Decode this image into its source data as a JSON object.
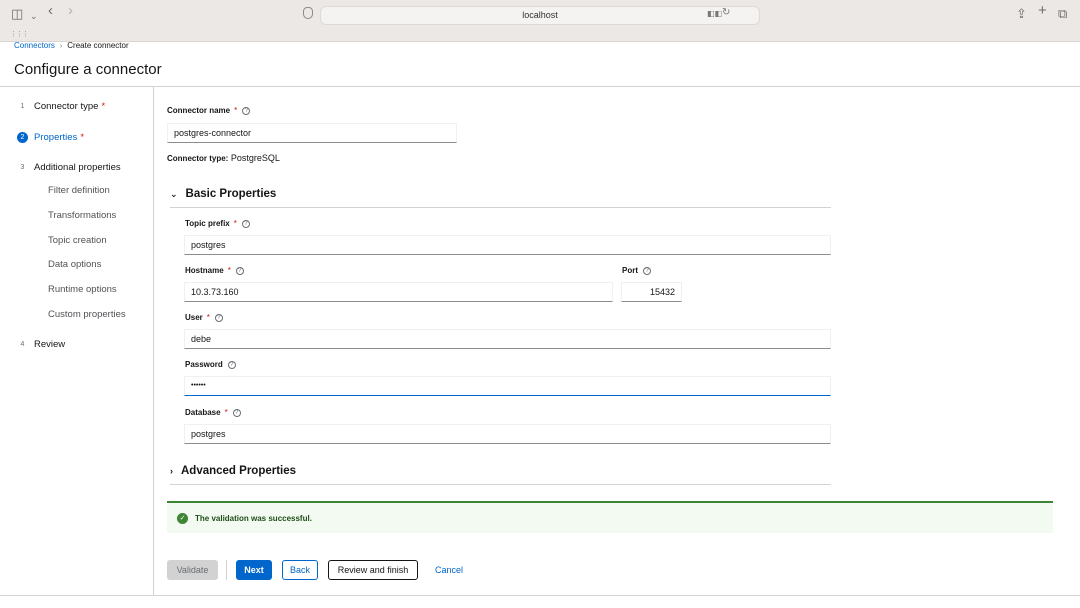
{
  "browser": {
    "url": "localhost",
    "icons": [
      "sidebar-icon",
      "chevron-down-icon",
      "back-icon",
      "forward-icon",
      "shield-icon",
      "translate-icon",
      "reload-icon",
      "share-icon",
      "new-tab-icon",
      "tabs-icon",
      "grid-icon"
    ]
  },
  "breadcrumb": {
    "root": "Connectors",
    "current": "Create connector"
  },
  "page_title": "Configure a connector",
  "wizard_nav": {
    "steps": [
      {
        "num": "1",
        "label": "Connector type",
        "required": "*"
      },
      {
        "num": "2",
        "label": "Properties",
        "required": "*"
      },
      {
        "num": "3",
        "label": "Additional properties"
      },
      {
        "num": "4",
        "label": "Review"
      }
    ],
    "substeps": [
      "Filter definition",
      "Transformations",
      "Topic creation",
      "Data options",
      "Runtime options",
      "Custom properties"
    ]
  },
  "form": {
    "connector_name_label": "Connector name",
    "connector_name_value": "postgres-connector",
    "connector_type_label": "Connector type:",
    "connector_type_value": "PostgreSQL",
    "basic_section": "Basic Properties",
    "topic_prefix_label": "Topic prefix",
    "topic_prefix_value": "postgres",
    "hostname_label": "Hostname",
    "hostname_value": "10.3.73.160",
    "port_label": "Port",
    "port_value": "15432",
    "user_label": "User",
    "user_value": "debe",
    "password_label": "Password",
    "password_value": "••••••",
    "database_label": "Database",
    "database_value": "postgres",
    "advanced_section": "Advanced Properties",
    "required_mark": "*",
    "help_glyph": "?"
  },
  "alert": {
    "message": "The validation was successful.",
    "status_color": "#3e8635"
  },
  "buttons": {
    "validate": "Validate",
    "next": "Next",
    "back": "Back",
    "review_finish": "Review and finish",
    "cancel": "Cancel"
  },
  "colors": {
    "accent": "#0066cc",
    "required": "#c9190b",
    "success": "#3e8635"
  }
}
